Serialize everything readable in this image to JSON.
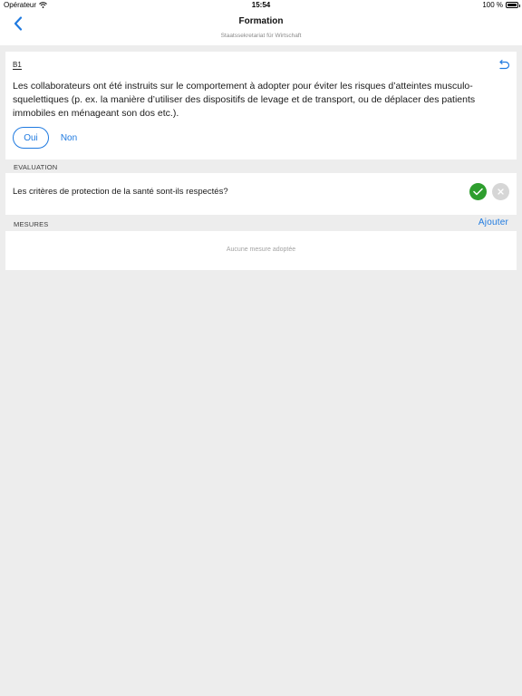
{
  "status_bar": {
    "carrier": "Opérateur",
    "time": "15:54",
    "battery": "100 %"
  },
  "nav": {
    "title": "Formation",
    "subtitle": "Staatssekretariat für Wirtschaft",
    "back_icon": "chevron-left-icon"
  },
  "question": {
    "code": "B1",
    "text": "Les collaborateurs ont été instruits sur le comportement à adopter pour éviter les risques d’atteintes musculo-squelettiques (p. ex. la manière d’utiliser des dispositifs de levage et de transport, ou de déplacer des patients immobiles en ménageant son dos etc.).",
    "yes_label": "Oui",
    "no_label": "Non",
    "selected": "Oui",
    "undo_icon": "undo-icon"
  },
  "evaluation": {
    "header": "EVALUATION",
    "text": "Les critères de protection de la santé sont-ils respectés?",
    "status": "yes",
    "accept_color": "#2e9e2e",
    "reject_color": "#d6d6d6"
  },
  "mesures": {
    "header": "MESURES",
    "add_label": "Ajouter",
    "empty_text": "Aucune mesure adoptée"
  },
  "colors": {
    "accent": "#1f7ae0",
    "background": "#ededed"
  }
}
